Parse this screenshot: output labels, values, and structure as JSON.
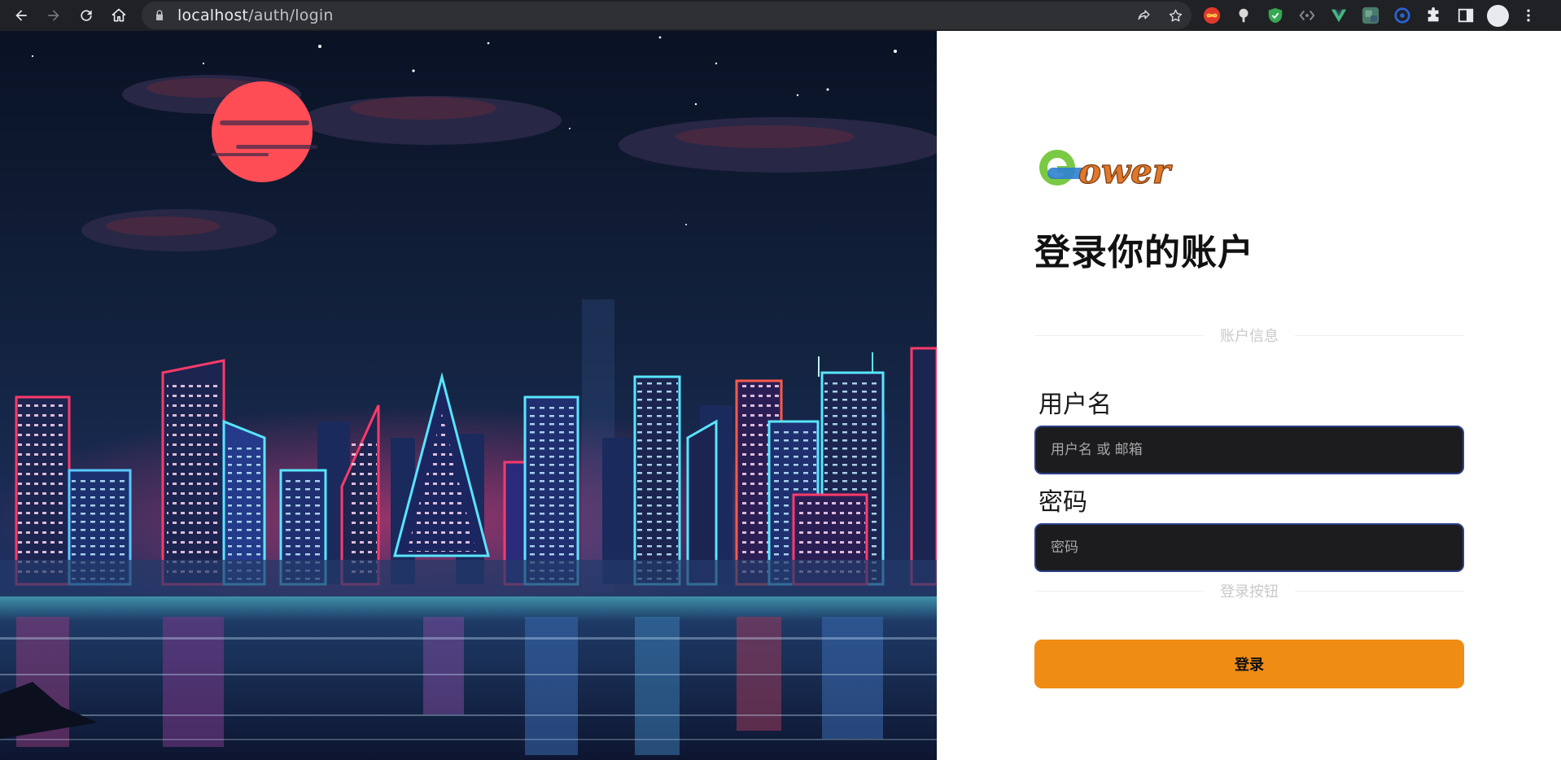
{
  "browser": {
    "url_host": "localhost",
    "url_path": "/auth/login",
    "extensions": [
      "infinity-extension-icon",
      "brush-extension-icon",
      "shield-extension-icon",
      "code-extension-icon",
      "vue-devtools-icon",
      "blurred-extension-icon",
      "circle-extension-icon",
      "puzzle-icon",
      "sidebar-icon"
    ]
  },
  "login": {
    "logo_text": "Gower",
    "title": "登录你的账户",
    "account_divider": "账户信息",
    "username_label": "用户名",
    "username_placeholder": "用户名 或 邮箱",
    "password_label": "密码",
    "password_placeholder": "密码",
    "button_divider": "登录按钮",
    "submit_label": "登录"
  },
  "colors": {
    "accent": "#ef8c14",
    "input_bg": "#1c1c1e",
    "input_border": "#2c3f87",
    "moon": "#ff4d55"
  }
}
